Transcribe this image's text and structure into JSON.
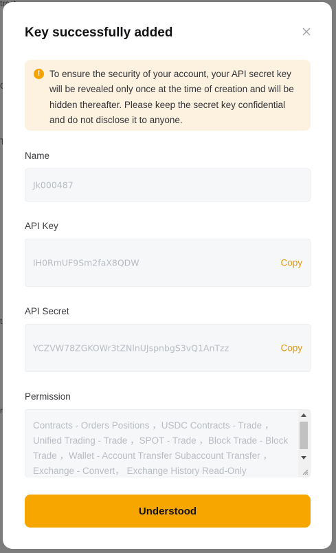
{
  "backdrop": {
    "fragments": [
      "tract",
      "C",
      "T",
      "t",
      "r"
    ]
  },
  "modal": {
    "title": "Key successfully added",
    "close_icon": "close-icon",
    "notice": {
      "icon": "warning-icon",
      "icon_glyph": "!",
      "text": "To ensure the security of your account, your API secret key will be revealed only once at the time of creation and will be hidden thereafter. Please keep the secret key confidential and do not disclose it to anyone."
    },
    "name": {
      "label": "Name",
      "value": "Jk000487"
    },
    "api_key": {
      "label": "API Key",
      "value": "IH0RmUF9Sm2faX8QDW",
      "copy_label": "Copy"
    },
    "api_secret": {
      "label": "API Secret",
      "value": "YCZVW78ZGKOWr3tZNlnUJspnbgS3vQ1AnTzz",
      "copy_label": "Copy"
    },
    "permission": {
      "label": "Permission",
      "value": "Contracts - Orders Positions ，USDC Contracts - Trade ，Unified Trading - Trade ，SPOT - Trade ，Block Trade - Block Trade ，Wallet - Account Transfer Subaccount Transfer ，Exchange - Convert， Exchange History  Read-Only"
    },
    "confirm_button": "Understood"
  },
  "colors": {
    "accent": "#f7a600",
    "copy_link": "#e6990b",
    "notice_bg": "#fdf1e0"
  }
}
